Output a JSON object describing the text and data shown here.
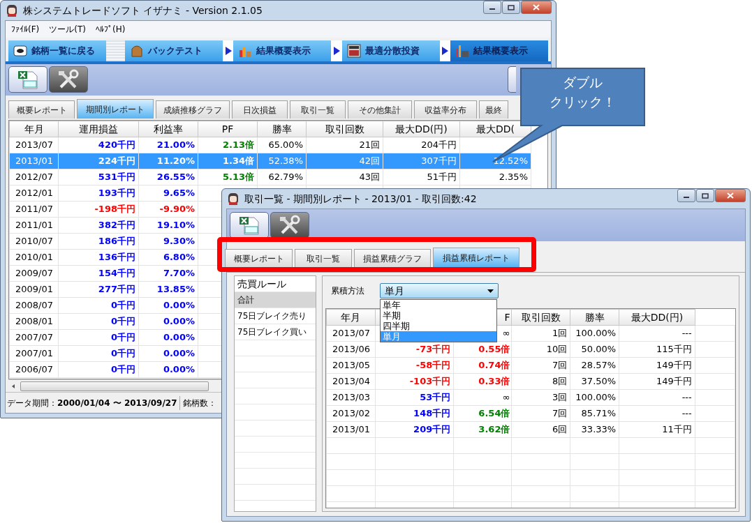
{
  "main_window": {
    "title": "株システムトレードソフト イザナミ - Version 2.1.05",
    "menu": [
      "ﾌｧｲﾙ(F)",
      "ツール(T)",
      "ﾍﾙﾌﾟ(H)"
    ],
    "nav": [
      {
        "kind": "step",
        "label": "銘柄一覧に戻る",
        "selected": false
      },
      {
        "kind": "step",
        "label": "バックテスト",
        "selected": false
      },
      {
        "kind": "arrow"
      },
      {
        "kind": "step",
        "label": "結果概要表示",
        "selected": false
      },
      {
        "kind": "arrow"
      },
      {
        "kind": "step",
        "label": "最適分散投資",
        "selected": false
      },
      {
        "kind": "arrow"
      },
      {
        "kind": "step",
        "label": "結果概要表示",
        "selected": true
      }
    ],
    "tabs": [
      {
        "label": "概要レポート",
        "selected": false
      },
      {
        "label": "期間別レポート",
        "selected": true
      },
      {
        "label": "成績推移グラフ",
        "selected": false
      },
      {
        "label": "日次損益",
        "selected": false
      },
      {
        "label": "取引一覧",
        "selected": false
      },
      {
        "label": "その他集計",
        "selected": false
      },
      {
        "label": "収益率分布",
        "selected": false
      },
      {
        "label": "最終",
        "selected": false
      }
    ],
    "table": {
      "columns": [
        "年月",
        "運用損益",
        "利益率",
        "PF",
        "勝率",
        "取引回数",
        "最大DD(円)",
        "最大DD("
      ],
      "rows": [
        {
          "selected": false,
          "cells": [
            {
              "text": "2013/07"
            },
            {
              "text": "420千円",
              "color": "#0000ff"
            },
            {
              "text": "21.00%",
              "color": "#0000ff"
            },
            {
              "text": "2.13倍",
              "color": "#008000"
            },
            {
              "text": "65.00%"
            },
            {
              "text": "21回"
            },
            {
              "text": "204千円"
            }
          ]
        },
        {
          "selected": true,
          "cells": [
            {
              "text": "2013/01"
            },
            {
              "text": "224千円",
              "bold": true
            },
            {
              "text": "11.20%",
              "bold": true
            },
            {
              "text": "1.34倍",
              "bold": true
            },
            {
              "text": "52.38%"
            },
            {
              "text": "42回"
            },
            {
              "text": "307千円"
            },
            {
              "text": "12.52%"
            }
          ]
        },
        {
          "selected": false,
          "cells": [
            {
              "text": "2012/07"
            },
            {
              "text": "531千円",
              "color": "#0000ff"
            },
            {
              "text": "26.55%",
              "color": "#0000ff"
            },
            {
              "text": "5.13倍",
              "color": "#008000"
            },
            {
              "text": "62.79%"
            },
            {
              "text": "43回"
            },
            {
              "text": "51千円"
            },
            {
              "text": "2.35%"
            }
          ]
        },
        {
          "selected": false,
          "cells": [
            {
              "text": "2012/01"
            },
            {
              "text": "193千円",
              "color": "#0000ff"
            },
            {
              "text": "9.65%",
              "color": "#0000ff"
            }
          ]
        },
        {
          "selected": false,
          "cells": [
            {
              "text": "2011/07"
            },
            {
              "text": "-198千円",
              "color": "#ff0000"
            },
            {
              "text": "-9.90%",
              "color": "#ff0000"
            }
          ]
        },
        {
          "selected": false,
          "cells": [
            {
              "text": "2011/01"
            },
            {
              "text": "382千円",
              "color": "#0000ff"
            },
            {
              "text": "19.10%",
              "color": "#0000ff"
            }
          ]
        },
        {
          "selected": false,
          "cells": [
            {
              "text": "2010/07"
            },
            {
              "text": "186千円",
              "color": "#0000ff"
            },
            {
              "text": "9.30%",
              "color": "#0000ff"
            }
          ]
        },
        {
          "selected": false,
          "cells": [
            {
              "text": "2010/01"
            },
            {
              "text": "136千円",
              "color": "#0000ff"
            },
            {
              "text": "6.80%",
              "color": "#0000ff"
            }
          ]
        },
        {
          "selected": false,
          "cells": [
            {
              "text": "2009/07"
            },
            {
              "text": "154千円",
              "color": "#0000ff"
            },
            {
              "text": "7.70%",
              "color": "#0000ff"
            }
          ]
        },
        {
          "selected": false,
          "cells": [
            {
              "text": "2009/01"
            },
            {
              "text": "277千円",
              "color": "#0000ff"
            },
            {
              "text": "13.85%",
              "color": "#0000ff"
            }
          ]
        },
        {
          "selected": false,
          "cells": [
            {
              "text": "2008/07"
            },
            {
              "text": "0千円",
              "color": "#0000ff"
            },
            {
              "text": "0.00%",
              "color": "#0000ff"
            }
          ]
        },
        {
          "selected": false,
          "cells": [
            {
              "text": "2008/01"
            },
            {
              "text": "0千円",
              "color": "#0000ff"
            },
            {
              "text": "0.00%",
              "color": "#0000ff"
            }
          ]
        },
        {
          "selected": false,
          "cells": [
            {
              "text": "2007/07"
            },
            {
              "text": "0千円",
              "color": "#0000ff"
            },
            {
              "text": "0.00%",
              "color": "#0000ff"
            }
          ]
        },
        {
          "selected": false,
          "cells": [
            {
              "text": "2007/01"
            },
            {
              "text": "0千円",
              "color": "#0000ff"
            },
            {
              "text": "0.00%",
              "color": "#0000ff"
            }
          ]
        },
        {
          "selected": false,
          "cells": [
            {
              "text": "2006/07"
            },
            {
              "text": "0千円",
              "color": "#0000ff"
            },
            {
              "text": "0.00%",
              "color": "#0000ff"
            }
          ]
        }
      ]
    },
    "status_bar": [
      "データ期間：**2000/01/04 〜 2013/09/27**",
      "銘柄数："
    ]
  },
  "callout": {
    "lines": [
      "ダブル",
      "クリック！"
    ]
  },
  "detail_window": {
    "title": "取引一覧 - 期間別レポート - 2013/01 - 取引回数:42",
    "tabs_highlighted": true,
    "tabs": [
      {
        "label": "概要レポート",
        "selected": false
      },
      {
        "label": "取引一覧",
        "selected": false
      },
      {
        "label": "損益累積グラフ",
        "selected": false
      },
      {
        "label": "損益累積レポート",
        "selected": true
      }
    ],
    "sidebar": {
      "heading": "売買ルール",
      "items": [
        {
          "label": "合計",
          "selected": true
        },
        {
          "label": "75日ブレイク売り",
          "selected": false
        },
        {
          "label": "75日ブレイク買い",
          "selected": false
        }
      ]
    },
    "filter": {
      "label": "累積方法",
      "value": "単月",
      "expanded": true,
      "options": [
        {
          "label": "単年",
          "selected": false
        },
        {
          "label": "半期",
          "selected": false
        },
        {
          "label": "四半期",
          "selected": false
        },
        {
          "label": "単月",
          "selected": true
        }
      ]
    },
    "table": {
      "columns": [
        "年月",
        null,
        "F",
        "取引回数",
        "勝率",
        "最大DD(円)"
      ],
      "rows": [
        {
          "cells": [
            {
              "text": "2013/07"
            },
            null,
            {
              "text": "∞"
            },
            {
              "text": "1回"
            },
            {
              "text": "100.00%"
            },
            {
              "text": "---"
            }
          ]
        },
        {
          "cells": [
            {
              "text": "2013/06"
            },
            {
              "text": "-73千円",
              "color": "#ff0000"
            },
            {
              "text": "0.55倍",
              "color": "#ff0000"
            },
            {
              "text": "10回"
            },
            {
              "text": "50.00%"
            },
            {
              "text": "115千円"
            }
          ]
        },
        {
          "cells": [
            {
              "text": "2013/05"
            },
            {
              "text": "-58千円",
              "color": "#ff0000"
            },
            {
              "text": "0.74倍",
              "color": "#ff0000"
            },
            {
              "text": "7回"
            },
            {
              "text": "28.57%"
            },
            {
              "text": "149千円"
            }
          ]
        },
        {
          "cells": [
            {
              "text": "2013/04"
            },
            {
              "text": "-103千円",
              "color": "#ff0000"
            },
            {
              "text": "0.33倍",
              "color": "#ff0000"
            },
            {
              "text": "8回"
            },
            {
              "text": "37.50%"
            },
            {
              "text": "149千円"
            }
          ]
        },
        {
          "cells": [
            {
              "text": "2013/03"
            },
            {
              "text": "53千円",
              "color": "#0000ff"
            },
            {
              "text": "∞"
            },
            {
              "text": "3回"
            },
            {
              "text": "100.00%"
            },
            {
              "text": "---"
            }
          ]
        },
        {
          "cells": [
            {
              "text": "2013/02"
            },
            {
              "text": "148千円",
              "color": "#0000ff"
            },
            {
              "text": "6.54倍",
              "color": "#008000"
            },
            {
              "text": "7回"
            },
            {
              "text": "85.71%"
            },
            {
              "text": "---"
            }
          ]
        },
        {
          "cells": [
            {
              "text": "2013/01"
            },
            {
              "text": "209千円",
              "color": "#0000ff"
            },
            {
              "text": "3.62倍",
              "color": "#008000"
            },
            {
              "text": "6回"
            },
            {
              "text": "33.33%"
            },
            {
              "text": "11千円"
            }
          ]
        }
      ]
    }
  }
}
